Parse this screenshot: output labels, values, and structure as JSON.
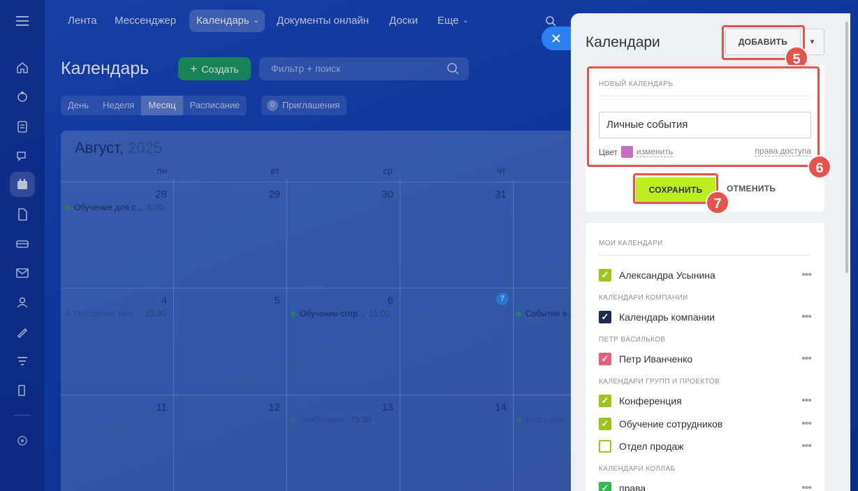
{
  "topnav": {
    "items": [
      "Лента",
      "Мессенджер",
      "Календарь",
      "Документы онлайн",
      "Доски",
      "Еще"
    ]
  },
  "calendar_page": {
    "title": "Календарь",
    "create_label": "Создать",
    "filter_placeholder": "Фильтр + поиск",
    "view_tabs": [
      "День",
      "Неделя",
      "Месяц",
      "Расписание"
    ],
    "invites_count": "0",
    "invites_label": "Приглашения",
    "month_label": "Август,",
    "year_label": "2025",
    "weekdays": [
      "пн",
      "вт",
      "ср",
      "чт"
    ],
    "week1_days": [
      "28",
      "29",
      "30",
      "31"
    ],
    "week2_days": [
      "4",
      "5",
      "6",
      "7"
    ],
    "week3_days": [
      "11",
      "12",
      "13",
      "14"
    ],
    "events": {
      "e1_title": "Обучение для с...",
      "e1_time": "9:00",
      "e2_title": "По сделке: Нов...",
      "e2_time": "10:30",
      "e3_title": "Обучение сотр...",
      "e3_time": "15:00",
      "e4_title": "Событие в...",
      "e5_title": "Тимбилдинг",
      "e5_time": "15:30",
      "e6_title": "Итоги пол..."
    }
  },
  "panel": {
    "title": "Календари",
    "add_label": "ДОБАВИТЬ",
    "new_calendar": {
      "caption": "НОВЫЙ КАЛЕНДАРЬ",
      "name_value": "Личные события",
      "color_label": "Цвет",
      "color_value": "#c56fc8",
      "change_label": "изменить",
      "access_label": "права доступа",
      "save_label": "СОХРАНИТЬ",
      "cancel_label": "ОТМЕНИТЬ"
    },
    "markers": {
      "m5": "5",
      "m6": "6",
      "m7": "7"
    },
    "sections": {
      "my": "МОИ КАЛЕНДАРИ",
      "company": "КАЛЕНДАРИ КОМПАНИИ",
      "petr": "ПЕТР ВАСИЛЬКОВ",
      "groups": "КАЛЕНДАРИ ГРУПП И ПРОЕКТОВ",
      "collab": "КАЛЕНДАРИ КОЛЛАБ"
    },
    "calendars": {
      "c1": "Александра Усынина",
      "c2": "Календарь компании",
      "c3": "Петр Иванченко",
      "c4": "Конференция",
      "c5": "Обучение сотрудников",
      "c6": "Отдел продаж",
      "c7": "права"
    },
    "more_glyph": "•••"
  },
  "colors": {
    "accent_red": "#e5534b",
    "save_green": "#bbed21",
    "check_green": "#9dc41a",
    "company_navy": "#1e2a52",
    "petr_pink": "#e5607c"
  }
}
